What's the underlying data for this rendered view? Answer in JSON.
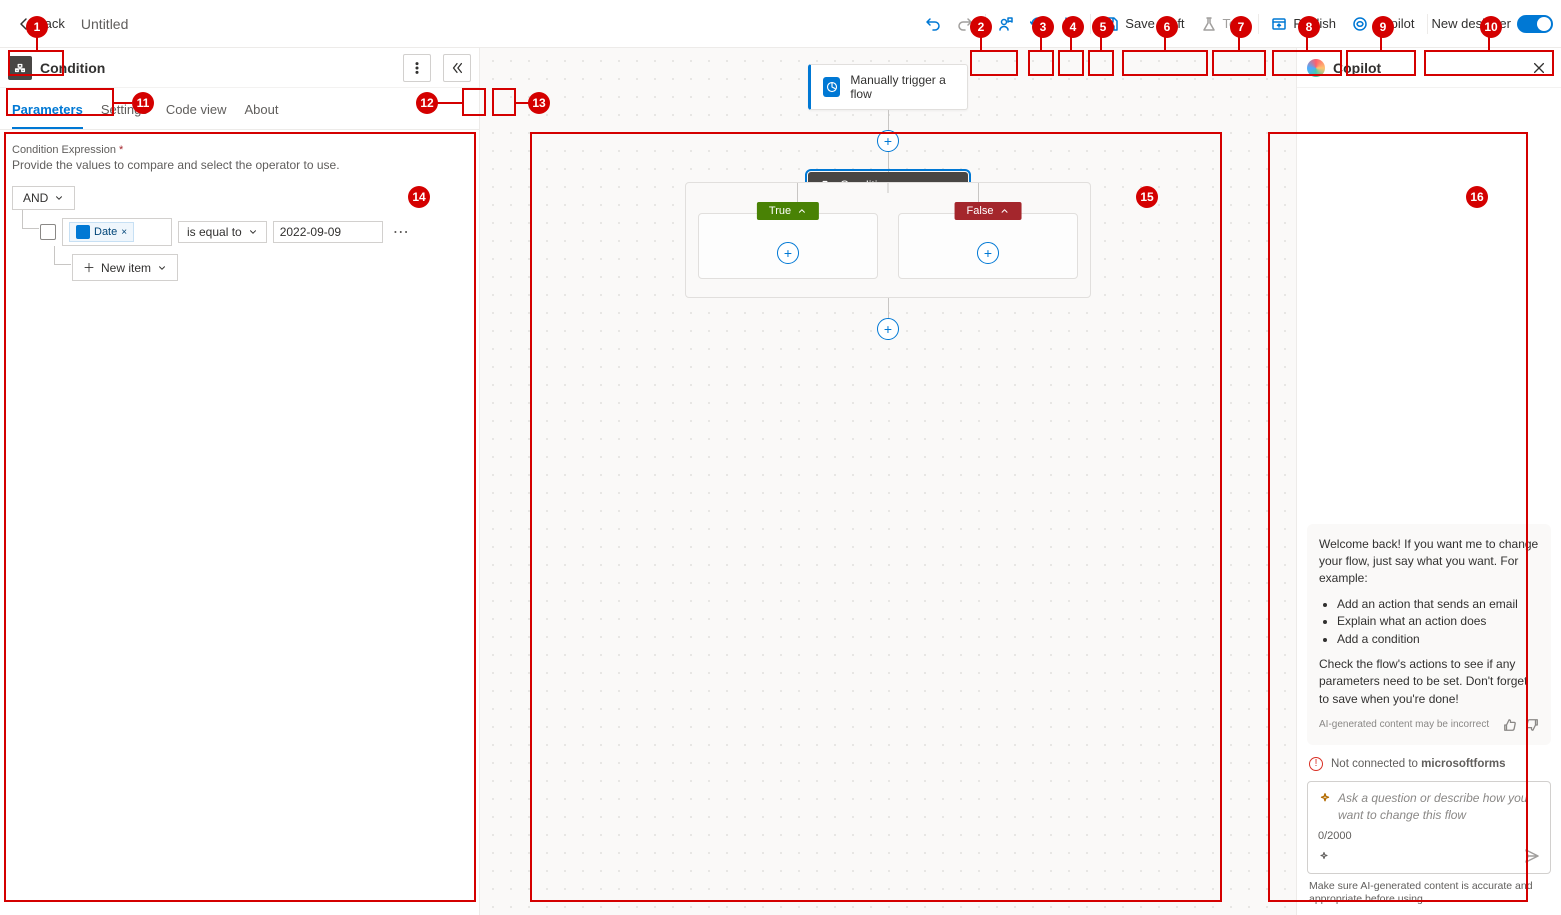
{
  "topbar": {
    "back": "Back",
    "title": "Untitled",
    "save_draft": "Save draft",
    "test": "Test",
    "publish": "Publish",
    "copilot": "Copilot",
    "new_designer": "New designer"
  },
  "panel": {
    "title": "Condition",
    "tabs": {
      "parameters": "Parameters",
      "settings": "Settings",
      "code_view": "Code view",
      "about": "About"
    },
    "field_label": "Condition Expression",
    "field_help": "Provide the values to compare and select the operator to use.",
    "logic": "AND",
    "row": {
      "chip": "Date",
      "chip_x": "×",
      "operator": "is equal to",
      "value": "2022-09-09"
    },
    "row_menu": "⋯",
    "new_item": "New item",
    "new_item_plus": "＋"
  },
  "canvas": {
    "trigger": "Manually trigger a flow",
    "condition": "Condition",
    "true": "True",
    "false": "False"
  },
  "copilot": {
    "title": "Copilot",
    "welcome_1": "Welcome back! If you want me to change your flow, just say what you want. For example:",
    "bullets": {
      "b1": "Add an action that sends an email",
      "b2": "Explain what an action does",
      "b3": "Add a condition"
    },
    "welcome_2": "Check the flow's actions to see if any parameters need to be set. Don't forget to save when you're done!",
    "disclaimer": "AI-generated content may be incorrect",
    "warn_pre": "Not connected to ",
    "warn_bold": "microsoftforms",
    "placeholder": "Ask a question or describe how you want to change this flow",
    "counter": "0/2000",
    "footer": "Make sure AI-generated content is accurate and appropriate before using."
  },
  "annotations": {
    "1": "1",
    "2": "2",
    "3": "3",
    "4": "4",
    "5": "5",
    "6": "6",
    "7": "7",
    "8": "8",
    "9": "9",
    "10": "10",
    "11": "11",
    "12": "12",
    "13": "13",
    "14": "14",
    "15": "15",
    "16": "16"
  }
}
